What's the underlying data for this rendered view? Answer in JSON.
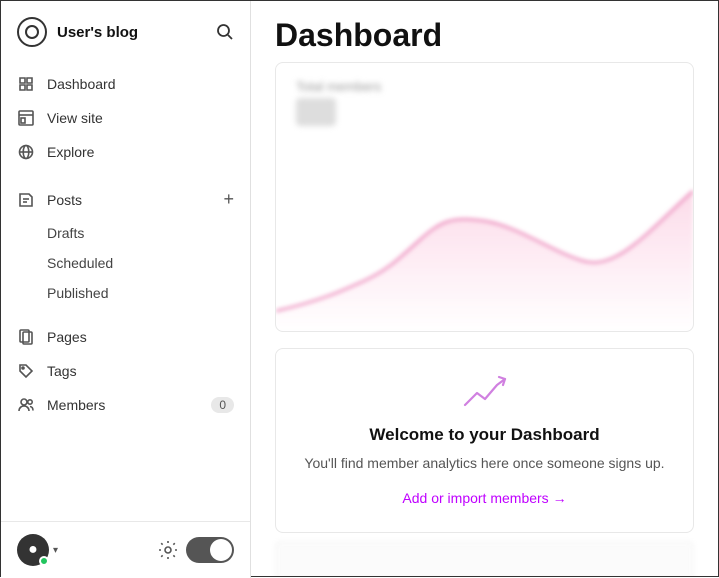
{
  "brand": {
    "name": "User's blog"
  },
  "sidebar": {
    "nav_items": [
      {
        "id": "dashboard",
        "label": "Dashboard",
        "icon": "dashboard-icon"
      },
      {
        "id": "view-site",
        "label": "View site",
        "icon": "view-site-icon"
      },
      {
        "id": "explore",
        "label": "Explore",
        "icon": "explore-icon"
      }
    ],
    "posts_section": {
      "label": "Posts",
      "sub_items": [
        {
          "id": "drafts",
          "label": "Drafts"
        },
        {
          "id": "scheduled",
          "label": "Scheduled"
        },
        {
          "id": "published",
          "label": "Published"
        }
      ]
    },
    "lower_nav": [
      {
        "id": "pages",
        "label": "Pages",
        "icon": "pages-icon"
      },
      {
        "id": "tags",
        "label": "Tags",
        "icon": "tags-icon"
      },
      {
        "id": "members",
        "label": "Members",
        "icon": "members-icon",
        "badge": "0"
      }
    ]
  },
  "main": {
    "title": "Dashboard",
    "stats_label": "Total members",
    "stats_value": "0",
    "welcome": {
      "title": "Welcome to your Dashboard",
      "subtitle": "You'll find member analytics here once someone signs up.",
      "cta": "Add or import members →"
    }
  },
  "footer": {
    "chevron": "▾",
    "cta_arrow": "→"
  }
}
